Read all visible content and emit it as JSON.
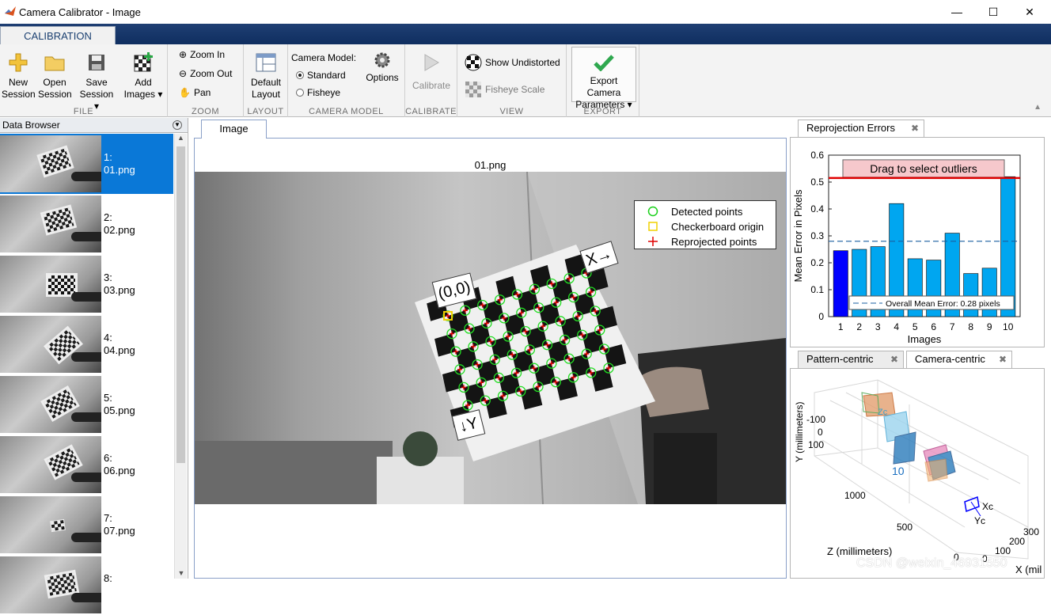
{
  "window": {
    "title": "Camera Calibrator - Image",
    "min": "—",
    "max": "☐",
    "close": "✕"
  },
  "ribbon": {
    "tab": "CALIBRATION",
    "file": {
      "label": "FILE",
      "new": [
        "New",
        "Session"
      ],
      "open": [
        "Open",
        "Session"
      ],
      "save": [
        "Save",
        "Session ▾"
      ],
      "add": [
        "Add",
        "Images ▾"
      ]
    },
    "zoom": {
      "label": "ZOOM",
      "zoom_in": "Zoom In",
      "zoom_out": "Zoom Out",
      "pan": "Pan"
    },
    "layout": {
      "label": "LAYOUT",
      "default": [
        "Default",
        "Layout"
      ]
    },
    "camera_model": {
      "label": "CAMERA MODEL",
      "title": "Camera Model:",
      "standard": "Standard",
      "fisheye": "Fisheye",
      "options": "Options",
      "selected": "Standard"
    },
    "calibrate": {
      "label": "CALIBRATE",
      "calibrate": "Calibrate"
    },
    "view": {
      "label": "VIEW",
      "show_undistorted": "Show Undistorted",
      "fisheye_scale": "Fisheye Scale"
    },
    "export": {
      "label": "EXPORT",
      "export": [
        "Export Camera",
        "Parameters ▾"
      ]
    }
  },
  "data_browser": {
    "title": "Data Browser",
    "items": [
      {
        "num": "1:",
        "file": "01.png",
        "selected": true
      },
      {
        "num": "2:",
        "file": "02.png"
      },
      {
        "num": "3:",
        "file": "03.png"
      },
      {
        "num": "4:",
        "file": "04.png"
      },
      {
        "num": "5:",
        "file": "05.png"
      },
      {
        "num": "6:",
        "file": "06.png"
      },
      {
        "num": "7:",
        "file": "07.png"
      },
      {
        "num": "8:",
        "file": ""
      }
    ]
  },
  "image_panel": {
    "tab": "Image",
    "title": "01.png",
    "origin_label": "(0,0)",
    "x_label": "X→",
    "y_label": "↓Y",
    "legend": [
      "Detected points",
      "Checkerboard origin",
      "Reprojected points"
    ]
  },
  "chart_data": [
    {
      "type": "bar",
      "title": "",
      "categories": [
        "1",
        "2",
        "3",
        "4",
        "5",
        "6",
        "7",
        "8",
        "9",
        "10"
      ],
      "values": [
        0.245,
        0.25,
        0.26,
        0.42,
        0.215,
        0.21,
        0.31,
        0.16,
        0.18,
        0.52
      ],
      "highlighted_index": 0,
      "xlabel": "Images",
      "ylabel": "Mean Error in Pixels",
      "ylim": [
        0,
        0.6
      ],
      "yticks": [
        "0",
        "0.1",
        "0.2",
        "0.3",
        "0.4",
        "0.5",
        "0.6"
      ],
      "mean_line": 0.28,
      "mean_label": "Overall Mean Error: 0.28 pixels",
      "threshold_line": 0.515,
      "drag_label": "Drag to select outliers",
      "colors": {
        "bar": "#00a6f0",
        "selected": "#0000ff",
        "threshold": "#e00000",
        "drag_box": "#f6c8cc"
      }
    }
  ],
  "reproj_tab": "Reprojection Errors",
  "extrinsics": {
    "tabs": [
      "Pattern-centric",
      "Camera-centric"
    ],
    "y_axis": "Y (millimeters)",
    "y_ticks": [
      "-100",
      "0",
      "100"
    ],
    "z_axis": "Z (millimeters)",
    "z_ticks": [
      "1000",
      "500",
      "0"
    ],
    "x_axis": "X (mil",
    "x_ticks": [
      "0",
      "100",
      "200",
      "300"
    ],
    "labels": [
      "10",
      "Xc",
      "Yc",
      "Zc"
    ]
  },
  "watermark": "CSDN @weixin_46931550"
}
